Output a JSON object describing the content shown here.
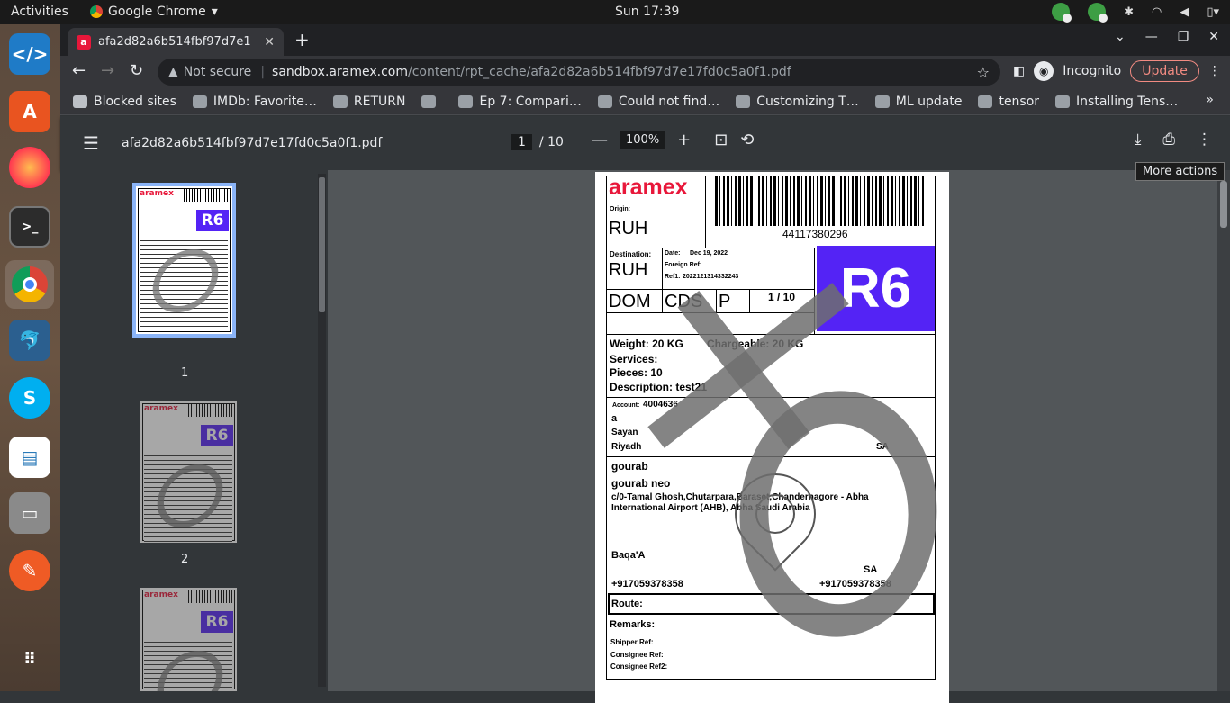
{
  "system": {
    "activities": "Activities",
    "app_name": "Google Chrome",
    "clock": "Sun 17:39"
  },
  "browser": {
    "tab_title": "afa2d82a6b514fbf97d7e1",
    "not_secure": "Not secure",
    "url_host": "sandbox.aramex.com",
    "url_path": "/content/rpt_cache/afa2d82a6b514fbf97d7e17fd0c5a0f1.pdf",
    "incognito": "Incognito",
    "update": "Update",
    "bookmarks": [
      {
        "label": "Blocked sites",
        "icon": "folder-icon"
      },
      {
        "label": "IMDb: Favorite…",
        "icon": "globe-icon"
      },
      {
        "label": "RETURN",
        "icon": "globe-icon"
      },
      {
        "label": "",
        "icon": "globe-icon"
      },
      {
        "label": "Ep 7: Compari…",
        "icon": "video-icon"
      },
      {
        "label": "Could not find…",
        "icon": "doc-icon"
      },
      {
        "label": "Customizing T…",
        "icon": "video-icon"
      },
      {
        "label": "ML update",
        "icon": "p-icon"
      },
      {
        "label": "tensor",
        "icon": "github-icon"
      },
      {
        "label": "Installing Tens…",
        "icon": "m-icon"
      }
    ],
    "more_bookmarks": "»"
  },
  "pdf": {
    "filename": "afa2d82a6b514fbf97d7e17fd0c5a0f1.pdf",
    "current_page": "1",
    "total_pages": "/ 10",
    "zoom": "100%",
    "tooltip": "More actions",
    "thumbnails": [
      {
        "number": "1",
        "selected": true
      },
      {
        "number": "2",
        "selected": false
      },
      {
        "number": "3",
        "selected": false
      }
    ]
  },
  "label": {
    "brand": "aramex",
    "origin_label": "Origin:",
    "origin": "RUH",
    "barcode_number": "44117380296",
    "destination_label": "Destination:",
    "destination": "RUH",
    "date_label": "Date:",
    "date": "Dec 19, 2022",
    "foreign_ref_label": "Foreign Ref:",
    "ref1_label": "Ref1:",
    "ref1": "2022121314332243",
    "product_group": "DOM",
    "product_type": "CDS",
    "payment": "P",
    "piece_count": "1 / 10",
    "route_code": "R6",
    "weight": "Weight: 20 KG",
    "chargeable": "Chargeable: 20 KG",
    "services": "Services:",
    "pieces": "Pieces: 10",
    "description": "Description: test21",
    "account_label": "Account:",
    "account": "4004636",
    "shipper_line1": "a",
    "shipper_name": "Sayan",
    "shipper_city": "Riyadh",
    "shipper_country": "SA",
    "consignee_name": "gourab",
    "consignee_contact": "gourab neo",
    "consignee_address1": "c/0-Tamal Ghosh,Chutarpara,Baraset,Chandernagore - Abha",
    "consignee_address2": "International Airport (AHB), Abha Saudi Arabia",
    "consignee_city": "Baqa'A",
    "consignee_country": "SA",
    "phone1": "+917059378358",
    "phone2": "+917059378358",
    "route": "Route:",
    "remarks": "Remarks:",
    "shipper_ref": "Shipper Ref:",
    "consignee_ref": "Consignee Ref:",
    "consignee_ref2": "Consignee Ref2:"
  }
}
